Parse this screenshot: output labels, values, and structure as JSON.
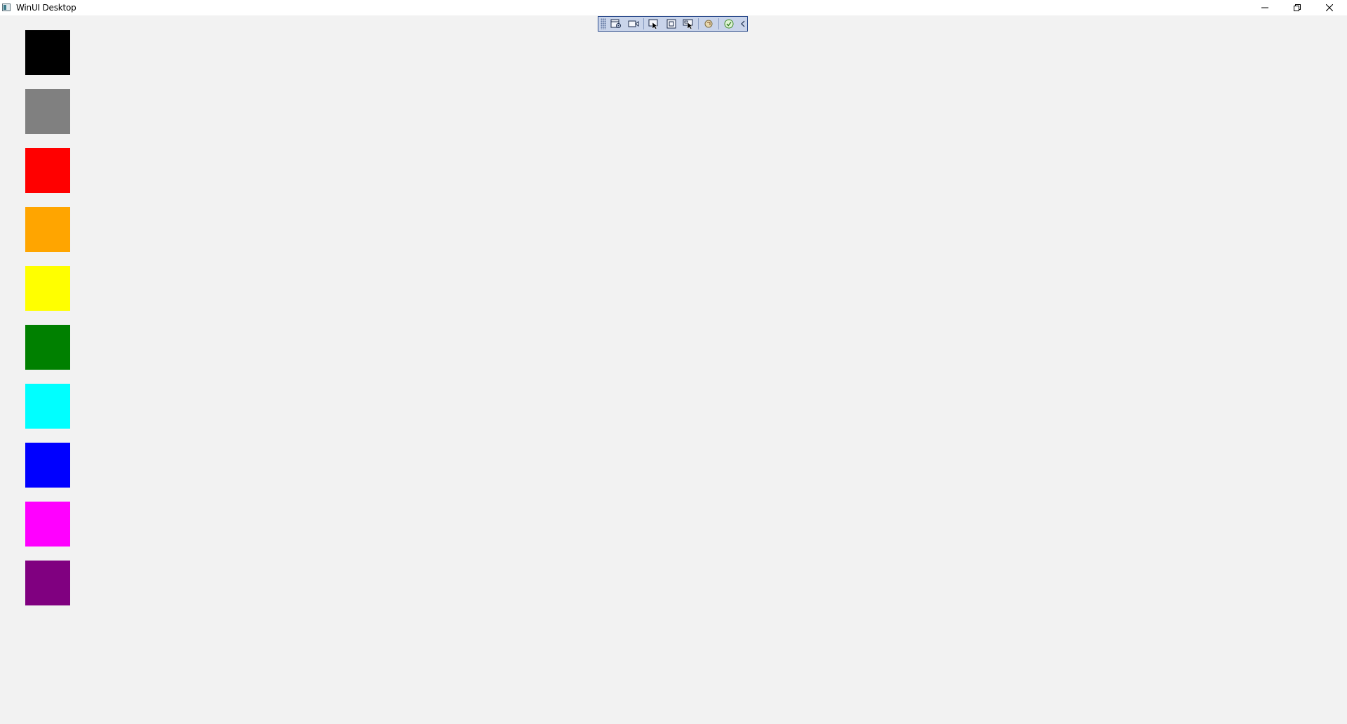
{
  "window": {
    "title": "WinUI Desktop"
  },
  "caption_buttons": {
    "minimize": "minimize-icon",
    "restore": "restore-icon",
    "close": "close-icon"
  },
  "debug_toolbar": {
    "buttons": [
      "app-toolbar-settings-icon",
      "record-camera-icon",
      "select-element-icon",
      "display-layout-adorners-icon",
      "track-focused-element-icon",
      "hot-reload-icon",
      "hot-reload-status-icon",
      "collapse-toolbar-icon"
    ],
    "background": "#c9d4ea",
    "border": "#2c4b8c"
  },
  "swatches": [
    {
      "name": "black",
      "color": "#000000"
    },
    {
      "name": "gray",
      "color": "#808080"
    },
    {
      "name": "red",
      "color": "#ff0000"
    },
    {
      "name": "orange",
      "color": "#ffa500"
    },
    {
      "name": "yellow",
      "color": "#ffff00"
    },
    {
      "name": "green",
      "color": "#008000"
    },
    {
      "name": "cyan",
      "color": "#00ffff"
    },
    {
      "name": "blue",
      "color": "#0000ff"
    },
    {
      "name": "magenta",
      "color": "#ff00ff"
    },
    {
      "name": "purple",
      "color": "#800080"
    }
  ]
}
